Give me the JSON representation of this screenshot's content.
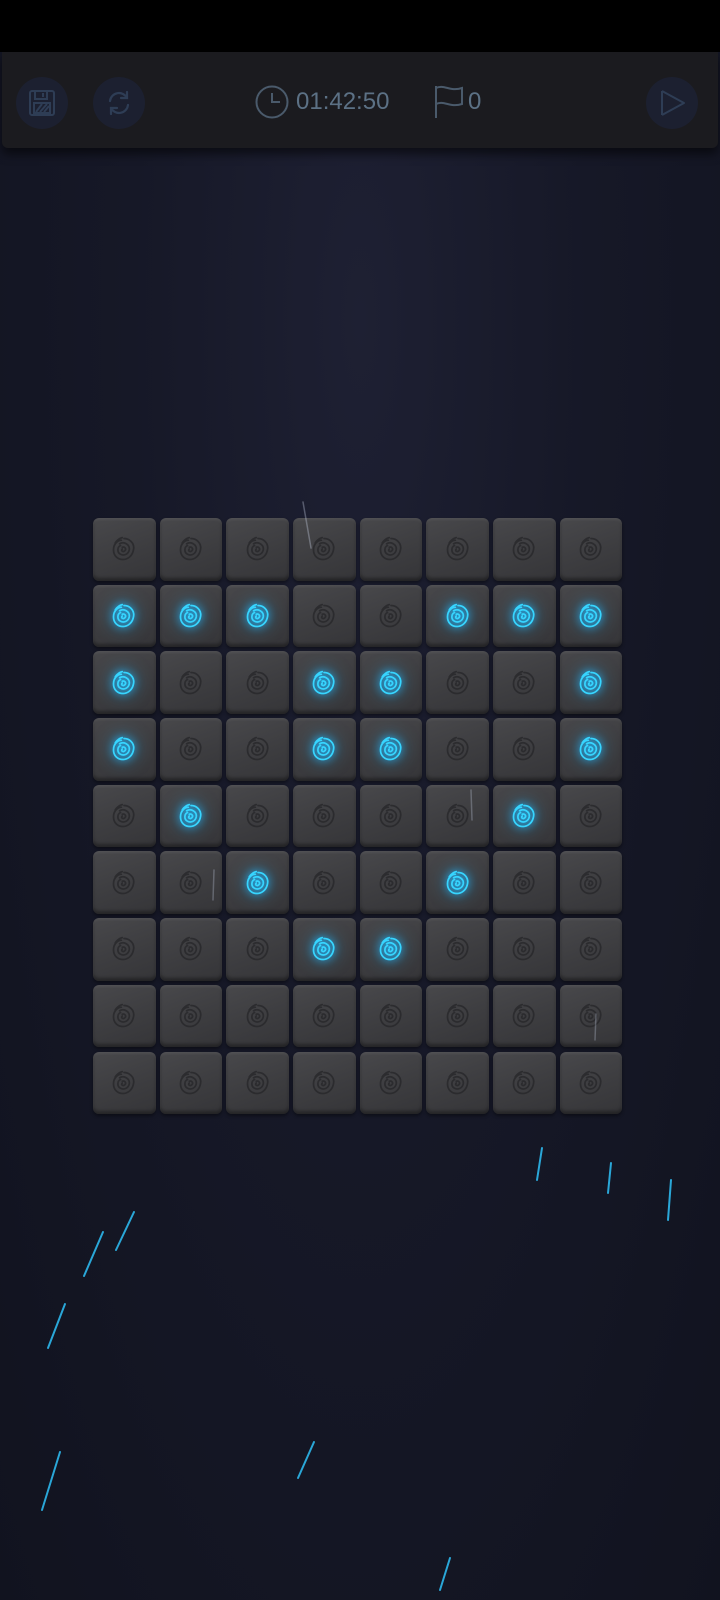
{
  "toolbar": {
    "timer_text": "01:42:50",
    "flag_count": "0",
    "save_icon": "floppy-disk-icon",
    "restart_icon": "refresh-icon",
    "timer_icon": "clock-icon",
    "flag_icon": "flag-icon",
    "send_icon": "play-triangle-icon"
  },
  "colors": {
    "background": "#161827",
    "tile": "#434346",
    "lit_rose": "#37d5ff",
    "dim_rose": "#2a2a2d",
    "toolbar_text": "#5c7185"
  },
  "board": {
    "columns": 8,
    "rows": 9,
    "lit": [
      [
        0,
        0,
        0,
        0,
        0,
        0,
        0,
        0
      ],
      [
        1,
        1,
        1,
        0,
        0,
        1,
        1,
        1
      ],
      [
        1,
        0,
        0,
        1,
        1,
        0,
        0,
        1
      ],
      [
        1,
        0,
        0,
        1,
        1,
        0,
        0,
        1
      ],
      [
        0,
        1,
        0,
        0,
        0,
        0,
        1,
        0
      ],
      [
        0,
        0,
        1,
        0,
        0,
        1,
        0,
        0
      ],
      [
        0,
        0,
        0,
        1,
        1,
        0,
        0,
        0
      ],
      [
        0,
        0,
        0,
        0,
        0,
        0,
        0,
        0
      ],
      [
        0,
        0,
        0,
        0,
        0,
        0,
        0,
        0
      ]
    ]
  }
}
